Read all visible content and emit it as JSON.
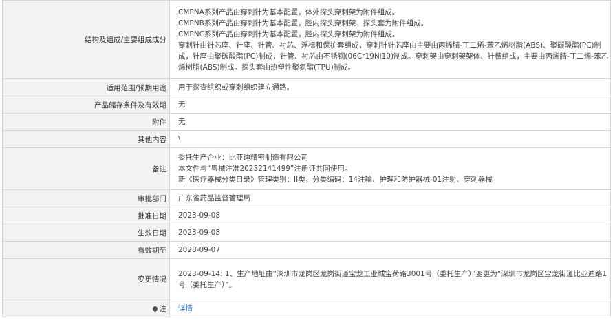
{
  "rows": {
    "structure": {
      "label": "结构及组成/主要组成成分",
      "lines": [
        "CMPNA系列产品由穿刺针为基本配置，体外探头穿刺架为附件组成。",
        "CMPNB系列产品由穿刺针为基本配置，腔内探头穿刺架、探头套为附件组成。",
        "CMPNC系列产品由穿刺针为基本配置，腔内探头穿刺架为附件组成。",
        "穿刺针由针芯座、针座、针管、衬芯、浮标和保护套组成，穿刺针针芯座由主要由丙烯腈-丁二烯-苯乙烯树脂(ABS)、聚碳酸酯(PC)制成，针座由聚碳酸酯(PC)制成，针管、衬芯由不锈钢(06Cr19Ni10)制成。穿刺架由穿刺架架体、针槽组成，主要由丙烯腈-丁二烯-苯乙烯树脂(ABS)制成。探头套由热塑性聚氨酯(TPU)制成。"
      ]
    },
    "scope": {
      "label": "适用范围/预期用途",
      "value": "用于探查组织或穿刺组织建立通路。"
    },
    "storage": {
      "label": "产品储存条件及有效期",
      "value": "无"
    },
    "accessories": {
      "label": "附件",
      "value": "无"
    },
    "other": {
      "label": "其他内容",
      "value": "\\"
    },
    "remarks": {
      "label": "备注",
      "lines": [
        "委托生产企业：比亚迪精密制造有限公司",
        "本文件与“粤械注准20232141499”注册证共同使用。",
        "新《医疗器械分类目录》管理类别：II类，分类编码：14注输、护理和防护器械-01注射、穿刺器械"
      ]
    },
    "dept": {
      "label": "审批部门",
      "value": "广东省药品监督管理局"
    },
    "approval_date": {
      "label": "批准日期",
      "value": "2023-09-08"
    },
    "effective_date": {
      "label": "生效日期",
      "value": "2023-09-08"
    },
    "expiry": {
      "label": "有效期至",
      "value": "2028-09-07"
    },
    "changes": {
      "label": "变更情况",
      "value": "2023-09-14: 1、生产地址由“深圳市龙岗区龙岗街道宝龙工业城宝荷路3001号（委托生产）”变更为“深圳市龙岗区宝龙街道比亚迪路1号（委托生产）”。"
    },
    "note": {
      "label": "注",
      "link": "详情",
      "icon": "map-pin-icon"
    }
  }
}
